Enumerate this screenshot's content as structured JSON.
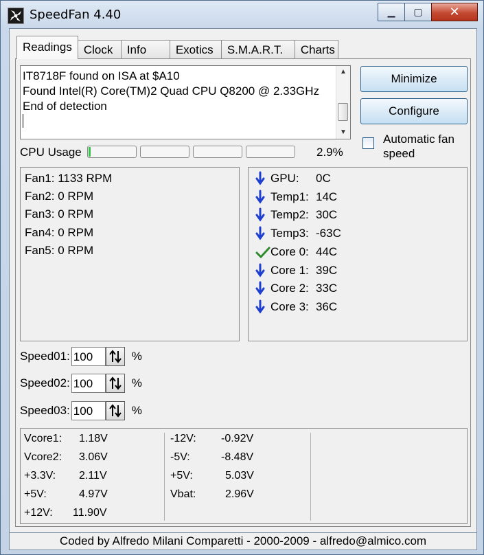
{
  "window": {
    "title": "SpeedFan 4.40",
    "controls": {
      "minimize": "▁",
      "maximize": "▢",
      "close": "✕"
    }
  },
  "tabs": [
    {
      "label": "Readings",
      "active": true
    },
    {
      "label": "Clock"
    },
    {
      "label": "Info"
    },
    {
      "label": "Exotics"
    },
    {
      "label": "S.M.A.R.T."
    },
    {
      "label": "Charts"
    }
  ],
  "log": {
    "lines": [
      "IT8718F found on ISA at $A10",
      "Found Intel(R) Core(TM)2 Quad CPU Q8200 @ 2.33GHz",
      "End of detection"
    ]
  },
  "buttons": {
    "minimize": "Minimize",
    "configure": "Configure"
  },
  "auto_fan": {
    "label": "Automatic fan speed",
    "checked": false
  },
  "cpu_usage": {
    "label": "CPU Usage",
    "value": "2.9%",
    "cores": [
      0.04,
      0,
      0,
      0
    ],
    "fill_color": "#37c34a"
  },
  "fans": [
    "Fan1: 1133 RPM",
    "Fan2: 0 RPM",
    "Fan3: 0 RPM",
    "Fan4: 0 RPM",
    "Fan5: 0 RPM"
  ],
  "temps": [
    {
      "name": "GPU:",
      "value": "0C",
      "icon": "arrow-down-icon"
    },
    {
      "name": "Temp1:",
      "value": "14C",
      "icon": "arrow-down-icon"
    },
    {
      "name": "Temp2:",
      "value": "30C",
      "icon": "arrow-down-icon"
    },
    {
      "name": "Temp3:",
      "value": "-63C",
      "icon": "arrow-down-icon"
    },
    {
      "name": "Core 0:",
      "value": "44C",
      "icon": "check-icon"
    },
    {
      "name": "Core 1:",
      "value": "39C",
      "icon": "arrow-down-icon"
    },
    {
      "name": "Core 2:",
      "value": "33C",
      "icon": "arrow-down-icon"
    },
    {
      "name": "Core 3:",
      "value": "36C",
      "icon": "arrow-down-icon"
    }
  ],
  "colors": {
    "arrow": "#1f3fd0",
    "check": "#2f8a2f"
  },
  "speeds": [
    {
      "label": "Speed01:",
      "value": "100",
      "unit": "%"
    },
    {
      "label": "Speed02:",
      "value": "100",
      "unit": "%"
    },
    {
      "label": "Speed03:",
      "value": "100",
      "unit": "%"
    }
  ],
  "voltages": {
    "col1": [
      {
        "name": "Vcore1:",
        "value": "1.18V"
      },
      {
        "name": "Vcore2:",
        "value": "3.06V"
      },
      {
        "name": "+3.3V:",
        "value": "2.11V"
      },
      {
        "name": "+5V:",
        "value": "4.97V"
      },
      {
        "name": "+12V:",
        "value": "11.90V"
      }
    ],
    "col2": [
      {
        "name": "-12V:",
        "value": "-0.92V"
      },
      {
        "name": "-5V:",
        "value": "-8.48V"
      },
      {
        "name": "+5V:",
        "value": "5.03V"
      },
      {
        "name": "Vbat:",
        "value": "2.96V"
      }
    ]
  },
  "footer": "Coded by Alfredo Milani Comparetti - 2000-2009 - alfredo@almico.com"
}
